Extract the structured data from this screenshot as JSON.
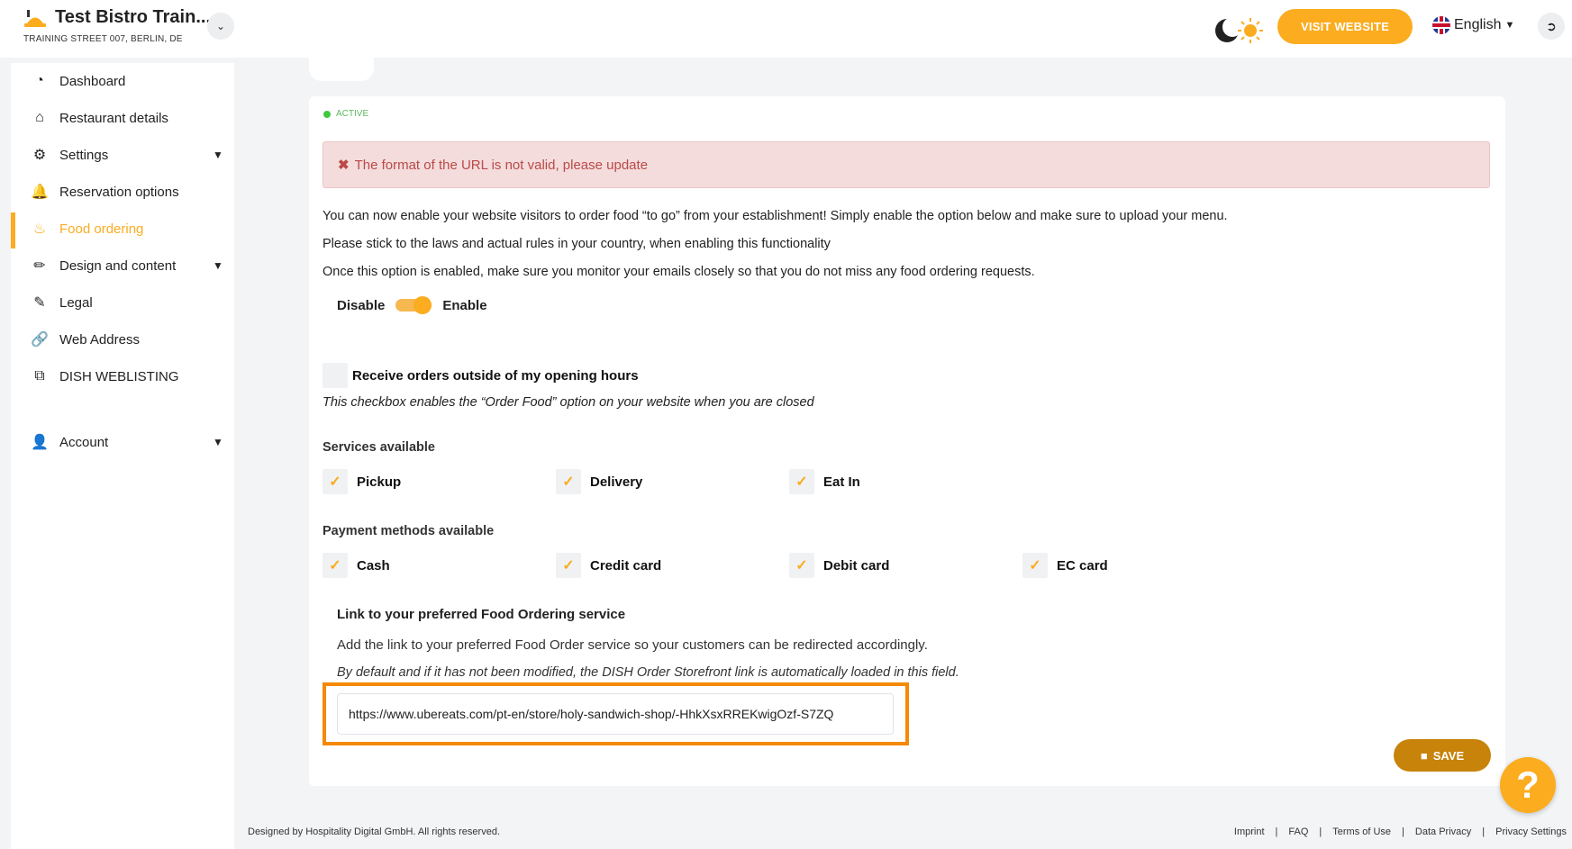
{
  "header": {
    "restaurant_name": "Test Bistro Train...",
    "address": "TRAINING STREET 007, BERLIN, DE",
    "visit_website_label": "VISIT WEBSITE",
    "language": "English"
  },
  "sidebar": {
    "items": [
      {
        "label": "Dashboard",
        "icon": "dashboard-icon"
      },
      {
        "label": "Restaurant details",
        "icon": "home-icon"
      },
      {
        "label": "Settings",
        "icon": "gear-icon"
      },
      {
        "label": "Reservation options",
        "icon": "bell-icon"
      },
      {
        "label": "Food ordering",
        "icon": "food-icon"
      },
      {
        "label": "Design and content",
        "icon": "brush-icon"
      },
      {
        "label": "Legal",
        "icon": "legal-icon"
      },
      {
        "label": "Web Address",
        "icon": "link-icon"
      },
      {
        "label": "DISH WEBLISTING",
        "icon": "share-icon"
      },
      {
        "label": "Account",
        "icon": "user-icon"
      }
    ]
  },
  "main": {
    "status": "ACTIVE",
    "error": "The format of the URL is not valid, please update",
    "intro": [
      "You can now enable your website visitors to order food “to go” from your establishment! Simply enable the option below and make sure to upload your menu.",
      "Please stick to the laws and actual rules in your country, when enabling this functionality",
      "Once this option is enabled, make sure you monitor your emails closely so that you do not miss any food ordering requests."
    ],
    "toggle": {
      "off_label": "Disable",
      "on_label": "Enable",
      "enabled": true
    },
    "outside_hours": {
      "label": "Receive orders outside of my opening hours",
      "description": "This checkbox enables the “Order Food” option on your website when you are closed",
      "checked": false
    },
    "services": {
      "title": "Services available",
      "options": [
        "Pickup",
        "Delivery",
        "Eat In"
      ]
    },
    "payments": {
      "title": "Payment methods available",
      "options": [
        "Cash",
        "Credit card",
        "Debit card",
        "EC card"
      ]
    },
    "link": {
      "title": "Link to your preferred Food Ordering service",
      "description": "Add the link to your preferred Food Order service so your customers can be redirected accordingly.",
      "note": "By default and if it has not been modified, the DISH Order Storefront link is automatically loaded in this field.",
      "value": "https://www.ubereats.com/pt-en/store/holy-sandwich-shop/-HhkXsxRREKwigOzf-S7ZQ"
    },
    "save_label": "SAVE"
  },
  "footer": {
    "copyright": "Designed by Hospitality Digital GmbH. All rights reserved.",
    "links": [
      "Imprint",
      "FAQ",
      "Terms of Use",
      "Data Privacy",
      "Privacy Settings"
    ]
  },
  "colors": {
    "accent": "#fbac1f",
    "save": "#c7830a",
    "highlight": "#f58a07",
    "error_bg": "#f4dcdc",
    "error_text": "#b94a48"
  }
}
